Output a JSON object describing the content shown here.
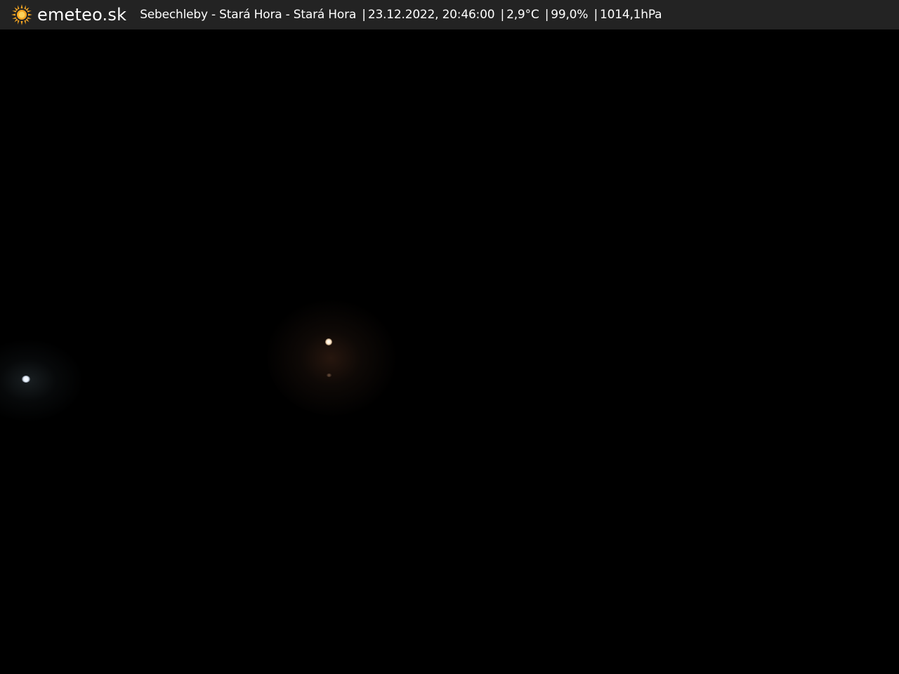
{
  "header": {
    "brand": "emeteo.sk",
    "location": "Sebechleby - Stará Hora - Stará Hora",
    "datetime": "23.12.2022, 20:46:00",
    "temperature": "2,9°C",
    "humidity": "99,0%",
    "pressure": "1014,1hPa",
    "separator": "|",
    "logo_icon": "sun-icon",
    "logo_color": "#f5a623"
  },
  "scene": {
    "background_color": "#000000"
  }
}
